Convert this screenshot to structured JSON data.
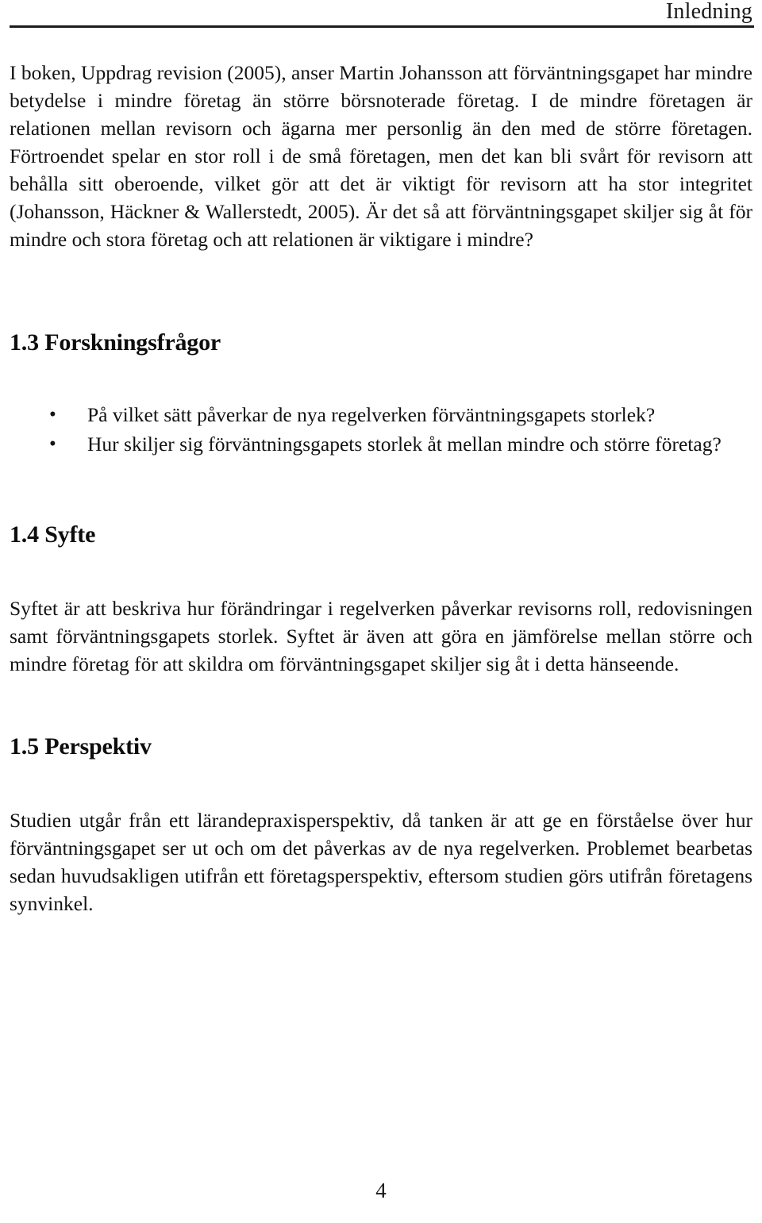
{
  "header": {
    "running_title": "Inledning"
  },
  "body": {
    "intro_paragraph": "I boken, Uppdrag revision (2005), anser Martin Johansson att förväntningsgapet har mindre betydelse i mindre företag än större börsnoterade företag. I de mindre företagen är relationen mellan revisorn och ägarna mer personlig än den med de större företagen. Förtroendet spelar en stor roll i de små företagen, men det kan bli svårt för revisorn att behålla sitt oberoende, vilket gör att det är viktigt för revisorn att ha stor integritet (Johansson, Häckner & Wallerstedt, 2005). Är det så att förväntningsgapet skiljer sig åt för mindre och stora företag och att relationen är viktigare i mindre?"
  },
  "sections": [
    {
      "number": "1.3",
      "title": "1.3 Forskningsfrågor",
      "bullets": [
        "På vilket sätt påverkar de nya regelverken förväntningsgapets storlek?",
        "Hur skiljer sig förväntningsgapets storlek åt mellan mindre och större företag?"
      ]
    },
    {
      "number": "1.4",
      "title": "1.4 Syfte",
      "paragraph": "Syftet är att beskriva hur förändringar i regelverken påverkar revisorns roll, redovisningen samt förväntningsgapets storlek. Syftet är även att göra en jämförelse mellan större och mindre företag för att skildra om förväntningsgapet skiljer sig åt i detta hänseende."
    },
    {
      "number": "1.5",
      "title": "1.5 Perspektiv",
      "paragraph": "Studien utgår från ett lärandepraxisperspektiv, då tanken är att ge en förståelse över hur förväntningsgapet ser ut och om det påverkas av de nya regelverken. Problemet bearbetas sedan huvudsakligen utifrån ett företagsperspektiv, eftersom studien görs utifrån företagens synvinkel."
    }
  ],
  "bullet_glyph": "•",
  "footer": {
    "page_number": "4"
  }
}
